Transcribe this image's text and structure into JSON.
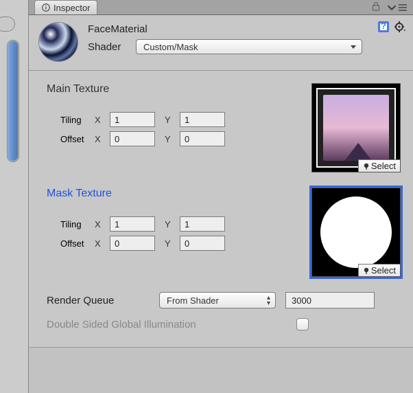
{
  "inspector": {
    "tab_label": "Inspector"
  },
  "header": {
    "title": "FaceMaterial",
    "shader_label": "Shader",
    "shader_value": "Custom/Mask"
  },
  "main_texture": {
    "title": "Main Texture",
    "tiling_label": "Tiling",
    "offset_label": "Offset",
    "x_label": "X",
    "y_label": "Y",
    "tiling_x": "1",
    "tiling_y": "1",
    "offset_x": "0",
    "offset_y": "0",
    "select_label": "Select"
  },
  "mask_texture": {
    "title": "Mask Texture",
    "tiling_label": "Tiling",
    "offset_label": "Offset",
    "x_label": "X",
    "y_label": "Y",
    "tiling_x": "1",
    "tiling_y": "1",
    "offset_x": "0",
    "offset_y": "0",
    "select_label": "Select"
  },
  "render_queue": {
    "label": "Render Queue",
    "dropdown_value": "From Shader",
    "value": "3000"
  },
  "double_sided_gi": {
    "label": "Double Sided Global Illumination",
    "checked": false
  }
}
